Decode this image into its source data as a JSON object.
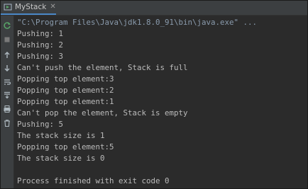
{
  "tab": {
    "label": "MyStack",
    "close_glyph": "✕",
    "icon": "run-app-icon"
  },
  "gutter_icons": [
    "rerun-icon",
    "stop-icon",
    "up-arrow-icon",
    "down-arrow-icon",
    "soft-wrap-icon",
    "scroll-to-end-icon",
    "print-icon",
    "delete-icon"
  ],
  "colors": {
    "tab_underline": "#4a88c7",
    "console_bg": "#2b2b2b",
    "console_text": "#bbbbbb",
    "command_text": "#8a9bad"
  },
  "console": {
    "command": "\"C:\\Program Files\\Java\\jdk1.8.0_91\\bin\\java.exe\" ...",
    "lines": [
      "Pushing: 1",
      "Pushing: 2",
      "Pushing: 3",
      "Can't push the element, Stack is full",
      "Popping top element:3",
      "Popping top element:2",
      "Popping top element:1",
      "Can't pop the element, Stack is empty",
      "Pushing: 5",
      "The stack size is 1",
      "Popping top element:5",
      "The stack size is 0",
      "",
      "Process finished with exit code 0"
    ]
  }
}
